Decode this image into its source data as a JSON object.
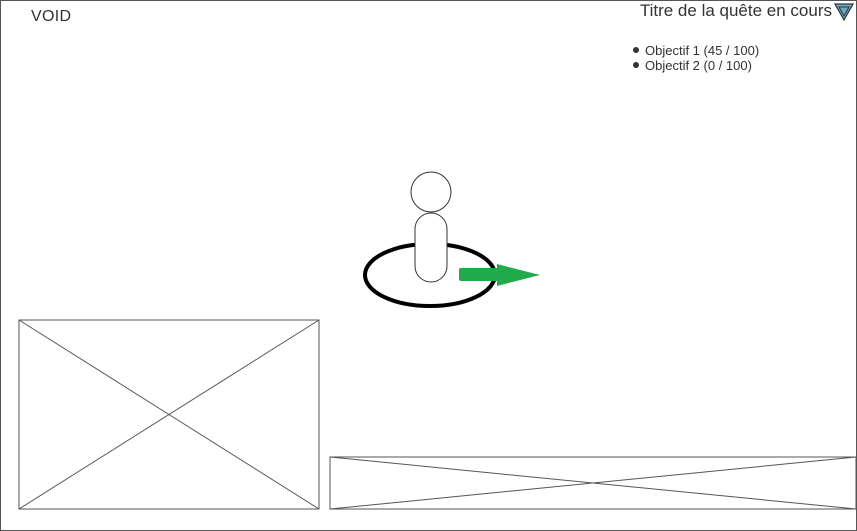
{
  "hud": {
    "area_name": "VOID",
    "quest": {
      "title": "Titre de la quête en cours",
      "objectives": [
        {
          "label": "Objectif 1 (45 / 100)"
        },
        {
          "label": "Objectif 2 (0 / 100)"
        }
      ]
    }
  },
  "icons": {
    "quest_toggle": "triangle-down-icon",
    "direction": "arrow-right-icon"
  },
  "colors": {
    "direction_arrow": "#22ab4a",
    "selection_ring": "#000000",
    "toggle_fill": "#6fa8c7",
    "wireframe_stroke": "#555555"
  }
}
